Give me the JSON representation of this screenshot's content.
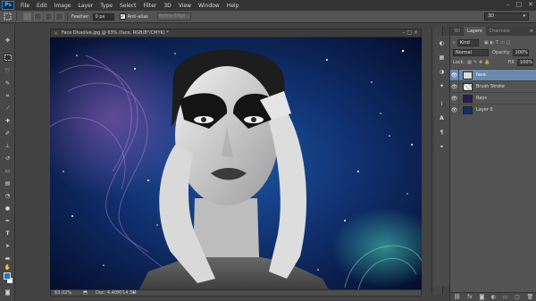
{
  "app": {
    "logo": "Ps"
  },
  "menu": [
    "File",
    "Edit",
    "Image",
    "Layer",
    "Type",
    "Select",
    "Filter",
    "3D",
    "View",
    "Window",
    "Help"
  ],
  "window_controls": {
    "minimize": "–",
    "maximize": "□",
    "close": "✕"
  },
  "options": {
    "feather_label": "Feather:",
    "feather_value": "0 px",
    "antialias_label": "Anti-alias",
    "antialias_checked": "✓",
    "refine_label": "Refine Edge...",
    "workspace": "3D"
  },
  "document": {
    "tab_title": "Face Dissolve.jpg @ 63% (face, RGB/8*/CMYK) *",
    "zoom": "63.02%",
    "doc_size": "Doc: 4.40M/14.3M"
  },
  "layers_panel": {
    "tabs": [
      "3D",
      "Layers",
      "Channels"
    ],
    "kind_label": "Kind",
    "blend_mode": "Normal",
    "opacity_label": "Opacity:",
    "opacity_value": "100%",
    "lock_label": "Lock:",
    "fill_label": "Fill:",
    "fill_value": "100%",
    "layers": [
      {
        "name": "face",
        "selected": true
      },
      {
        "name": "Brush Stroke",
        "selected": false
      },
      {
        "name": "Rays",
        "selected": false
      },
      {
        "name": "Layer 0",
        "selected": false
      }
    ]
  },
  "colors": {
    "foreground": "#1476d6",
    "background": "#ffffff",
    "accent": "#6c89b0"
  }
}
